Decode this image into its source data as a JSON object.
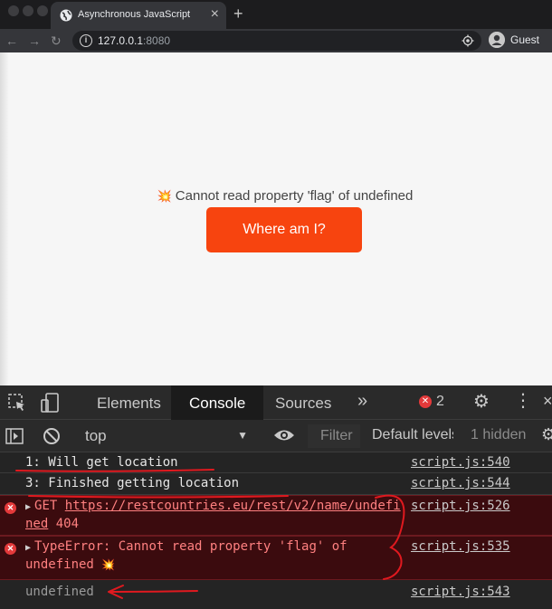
{
  "browser": {
    "tab_title": "Asynchronous JavaScript",
    "tab_close_glyph": "×",
    "new_tab_glyph": "+",
    "url_host": "127.0.0.1",
    "url_port": ":8080",
    "profile_label": "Guest"
  },
  "page": {
    "error_message": "Cannot read property 'flag' of undefined",
    "button_label": "Where am I?",
    "button_color": "#f7440f"
  },
  "devtools": {
    "tabs": [
      "Elements",
      "Console",
      "Sources"
    ],
    "active_tab": "Console",
    "more_tabs_glyph": "»",
    "error_count": "2",
    "context": "top",
    "filter_placeholder": "Filter",
    "levels": "Default levels",
    "hidden": "1 hidden",
    "console_rows": [
      {
        "kind": "log",
        "text": "1: Will get location",
        "source": "script.js:540"
      },
      {
        "kind": "log",
        "text": "3: Finished getting location",
        "source": "script.js:544"
      },
      {
        "kind": "error",
        "method": "GET",
        "url": "https://restcountries.eu/rest/v2/name/undefined",
        "status": "404",
        "source": "script.js:526"
      },
      {
        "kind": "error",
        "text": "TypeError: Cannot read property 'flag' of undefined",
        "source": "script.js:535"
      },
      {
        "kind": "log",
        "text": "undefined",
        "source": "script.js:543"
      }
    ]
  },
  "colors": {
    "error_red": "#e3393a",
    "annotation_red": "#e0191f"
  }
}
